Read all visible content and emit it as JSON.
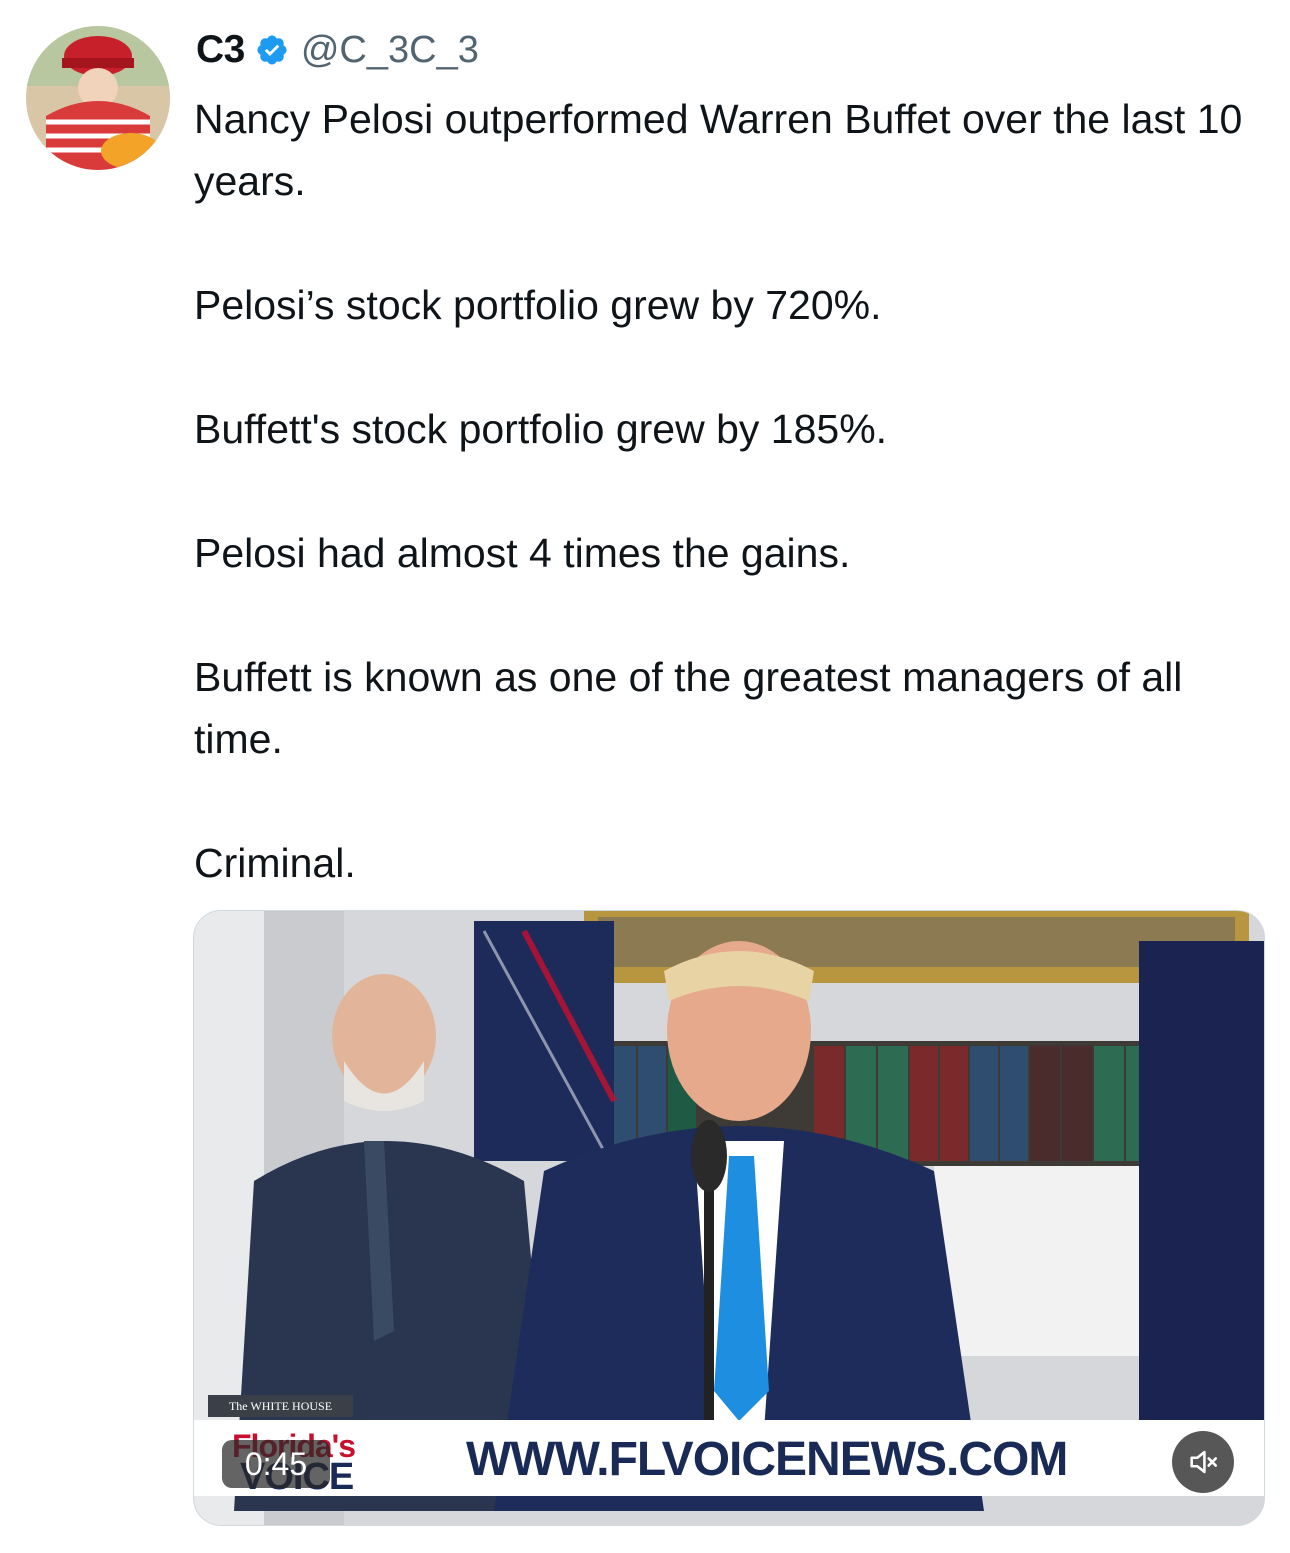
{
  "author": {
    "display_name": "C3",
    "handle": "@C_3C_3",
    "verified": true,
    "verified_color": "#1d9bf0"
  },
  "tweet": {
    "paragraphs": [
      "Nancy Pelosi outperformed Warren Buffet over the last 10 years.",
      "Pelosi’s stock portfolio grew by 720%.",
      "Buffett's stock portfolio grew by 185%.",
      "Pelosi had almost 4 times the gains.",
      "Buffett is known as one of the greatest managers of all time.",
      "Criminal."
    ]
  },
  "video": {
    "timestamp": "0:45",
    "logo_top": "Florida's",
    "logo_bottom": "VOICE",
    "website": "WWW.FLVOICENEWS.COM",
    "badge": "The WHITE HOUSE",
    "mute_icon": "speaker-muted-icon"
  }
}
